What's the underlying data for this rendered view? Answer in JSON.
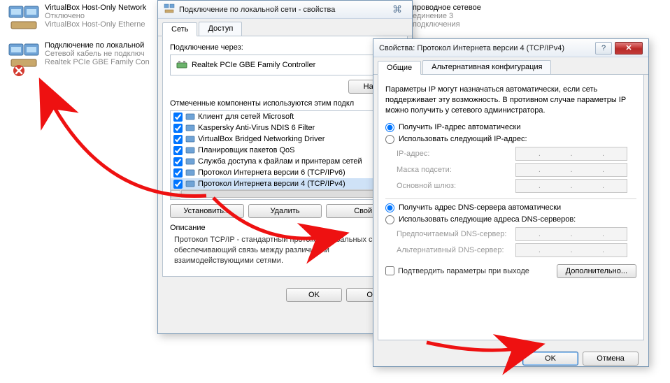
{
  "network_list": [
    {
      "name": "VirtualBox Host-Only Network",
      "status": "Отключено",
      "device": "VirtualBox Host-Only Etherne"
    },
    {
      "name": "Подключение по локальной",
      "status": "Сетевой кабель не подключ",
      "device": "Realtek PCIe GBE Family Con"
    },
    {
      "name_partial": "проводное сетевое",
      "status_partial": "единение 3",
      "device_partial": "подключения"
    }
  ],
  "dlg1": {
    "title": "Подключение по локальной сети - свойства",
    "tabs": {
      "network": "Сеть",
      "access": "Доступ"
    },
    "connect_via": "Подключение через:",
    "adapter": "Realtek PCIe GBE Family Controller",
    "configure": "Настр",
    "components_label": "Отмеченные компоненты используются этим подкл",
    "components": [
      {
        "checked": true,
        "label": "Клиент для сетей Microsoft"
      },
      {
        "checked": true,
        "label": "Kaspersky Anti-Virus NDIS 6 Filter"
      },
      {
        "checked": true,
        "label": "VirtualBox Bridged Networking Driver"
      },
      {
        "checked": true,
        "label": "Планировщик пакетов QoS"
      },
      {
        "checked": true,
        "label": "Служба доступа к файлам и принтерам сетей"
      },
      {
        "checked": true,
        "label": "Протокол Интернета версии 6 (TCP/IPv6)"
      },
      {
        "checked": true,
        "label": "Протокол Интернета версии 4 (TCP/IPv4)",
        "selected": true
      }
    ],
    "install": "Установить...",
    "remove": "Удалить",
    "properties": "Свой",
    "description_label": "Описание",
    "description": "Протокол TCP/IP - стандартный протокол глобальных сетей, обеспечивающий связь между различными взаимодействующими сетями.",
    "ok": "OK",
    "cancel": "Отм"
  },
  "dlg2": {
    "title": "Свойства: Протокол Интернета версии 4 (TCP/IPv4)",
    "tabs": {
      "general": "Общие",
      "alt": "Альтернативная конфигурация"
    },
    "info": "Параметры IP могут назначаться автоматически, если сеть поддерживает эту возможность. В противном случае параметры IP можно получить у сетевого администратора.",
    "radio_auto_ip": "Получить IP-адрес автоматически",
    "radio_manual_ip": "Использовать следующий IP-адрес:",
    "ip_address": "IP-адрес:",
    "subnet": "Маска подсети:",
    "gateway": "Основной шлюз:",
    "radio_auto_dns": "Получить адрес DNS-сервера автоматически",
    "radio_manual_dns": "Использовать следующие адреса DNS-серверов:",
    "dns_pref": "Предпочитаемый DNS-сервер:",
    "dns_alt": "Альтернативный DNS-сервер:",
    "confirm_exit": "Подтвердить параметры при выходе",
    "advanced": "Дополнительно...",
    "ok": "OK",
    "cancel": "Отмена"
  }
}
